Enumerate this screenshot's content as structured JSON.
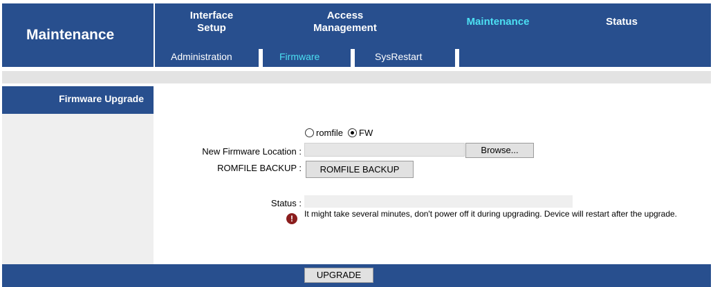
{
  "header": {
    "page_title": "Maintenance",
    "nav": [
      {
        "label": "Interface\nSetup"
      },
      {
        "label": "Access\nManagement"
      },
      {
        "label": "Maintenance"
      },
      {
        "label": "Status"
      }
    ],
    "subnav": [
      {
        "label": "Administration"
      },
      {
        "label": "Firmware"
      },
      {
        "label": "SysRestart"
      }
    ]
  },
  "section": {
    "title": "Firmware Upgrade"
  },
  "form": {
    "radio_options": [
      {
        "label": "romfile",
        "checked": false
      },
      {
        "label": "FW",
        "checked": true
      }
    ],
    "firmware_location_label": "New Firmware Location :",
    "firmware_location_value": "",
    "browse_button": "Browse...",
    "romfile_backup_label": "ROMFILE BACKUP :",
    "romfile_backup_button": "ROMFILE BACKUP",
    "status_label": "Status :",
    "status_value": "",
    "warning_text": "It might take several minutes, don't power off it during upgrading. Device will restart after the upgrade.",
    "upgrade_button": "UPGRADE"
  },
  "colors": {
    "header_blue": "#284f8e",
    "active_cyan": "#4ce0f3",
    "warning_red": "#8b1d1d"
  },
  "icons": {
    "warning": "alert-icon"
  }
}
